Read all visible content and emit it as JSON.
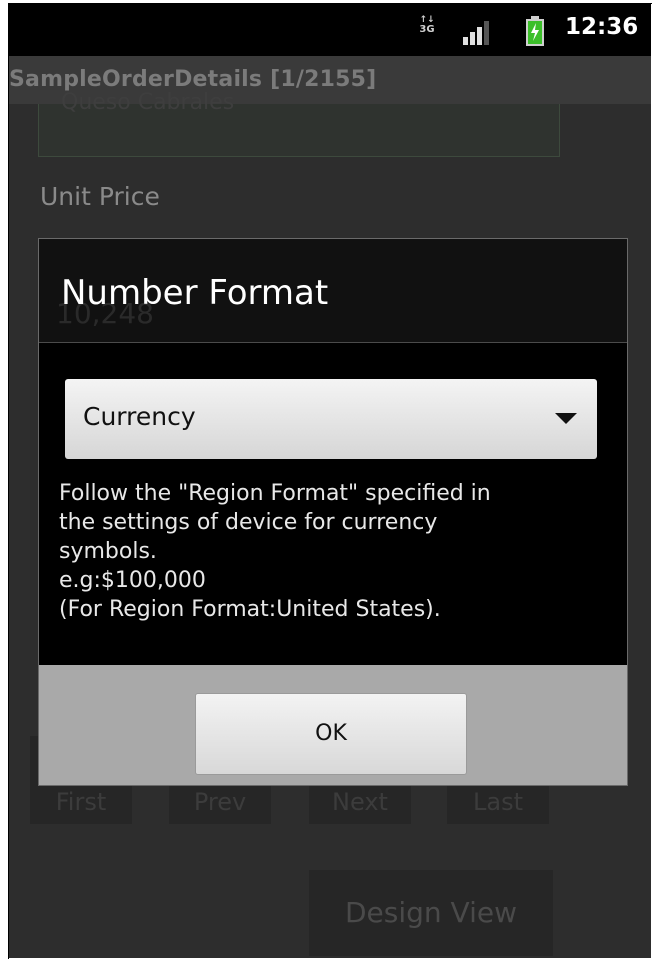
{
  "status_bar": {
    "network_type": "3G",
    "time": "12:36"
  },
  "title_bar": {
    "title": "SampleOrderDetails [1/2155]"
  },
  "background_form": {
    "previous_field_value": "Queso Cabrales",
    "unit_price_label": "Unit Price",
    "unit_price_value": "10,248",
    "nav_buttons": [
      "First",
      "Prev",
      "Next",
      "Last"
    ],
    "design_view_button": "Design View"
  },
  "dialog": {
    "title": "Number Format",
    "format_select": {
      "selected": "Currency"
    },
    "description_lines": [
      "Follow the \"Region Format\" specified in",
      "the settings of device for currency",
      "symbols.",
      "e.g:$100,000",
      "(For Region Format:United States)."
    ],
    "ok_button": "OK"
  },
  "colors": {
    "dialog_background": "#000000",
    "footer_background": "#a9a9a9",
    "battery_green": "#3cbf2a"
  },
  "icons": [
    "3g-icon",
    "signal-icon",
    "battery-icon",
    "dropdown-arrow-icon"
  ]
}
